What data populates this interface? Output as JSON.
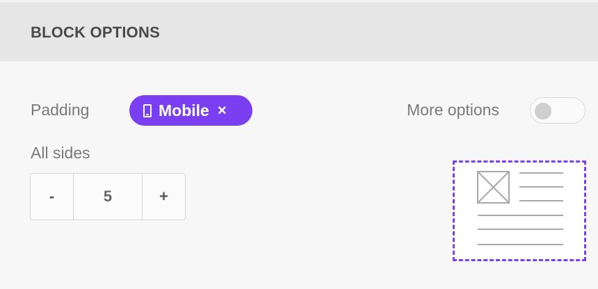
{
  "header": {
    "title": "BLOCK OPTIONS"
  },
  "padding": {
    "label": "Padding",
    "device_chip": {
      "label": "Mobile",
      "icon": "mobile-phone-icon",
      "close_symbol": "×"
    },
    "all_sides_label": "All sides",
    "stepper": {
      "minus": "-",
      "value": "5",
      "plus": "+"
    }
  },
  "more_options": {
    "label": "More options",
    "enabled": false
  },
  "colors": {
    "accent": "#7b3ff2",
    "header_bg": "#e6e6e6",
    "panel_bg": "#f7f7f7"
  }
}
